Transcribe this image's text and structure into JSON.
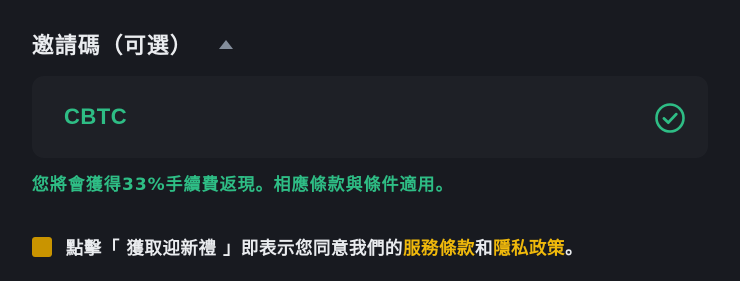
{
  "referral": {
    "title": "邀請碼（可選）",
    "code_value": "CBTC",
    "valid_icon": "check-circle-icon",
    "toggle_icon": "caret-up-icon",
    "success_message": "您將會獲得33%手續費返現。相應條款與條件適用。"
  },
  "consent": {
    "text_before": "點擊「 獲取迎新禮 」即表示您同意我們的",
    "terms_link": "服務條款",
    "conjunction": "和",
    "privacy_link": "隱私政策",
    "text_after": "。",
    "checked": true
  },
  "colors": {
    "background": "#181a20",
    "input_background": "#1e2026",
    "success_green": "#2ebd85",
    "link_yellow": "#f0b90b",
    "checkbox_yellow": "#c99400",
    "text_primary": "#eaecef",
    "text_secondary": "#848e9c"
  }
}
